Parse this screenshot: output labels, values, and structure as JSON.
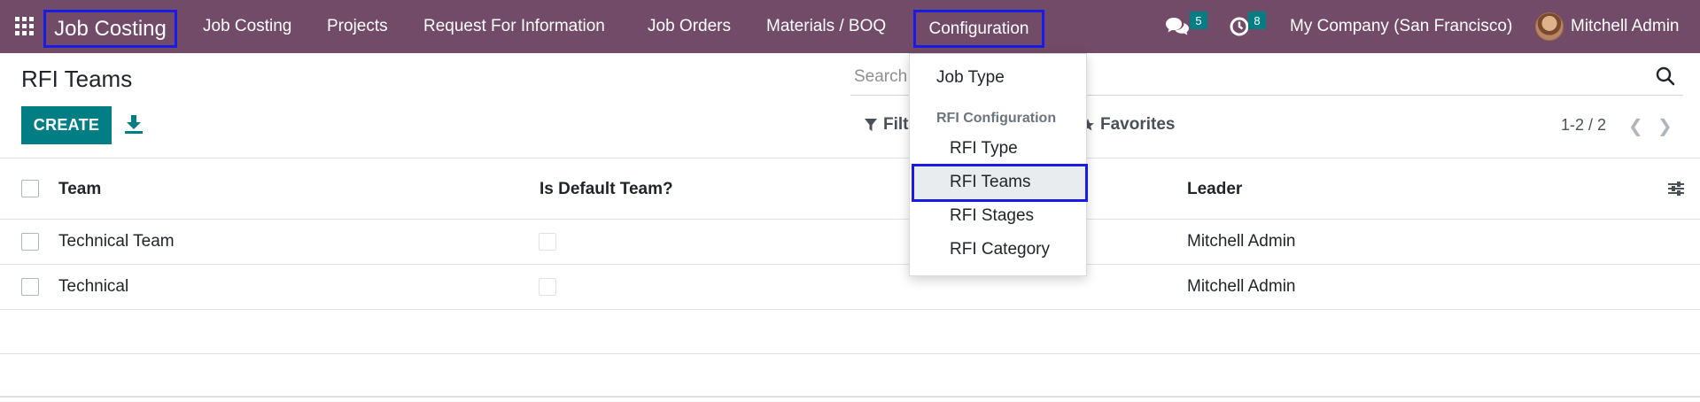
{
  "navbar": {
    "app_name": "Job Costing",
    "menus": [
      "Job Costing",
      "Projects",
      "Request For Information",
      "Job Orders",
      "Materials / BOQ",
      "Configuration"
    ],
    "messages_count": "5",
    "activities_count": "8",
    "company": "My Company (San Francisco)",
    "user": "Mitchell Admin",
    "accent_color": "#714b67",
    "highlight_color": "#1a1ae6"
  },
  "page": {
    "title": "RFI Teams",
    "create_label": "CREATE",
    "search_placeholder": "Search...",
    "filters_label": "Filters",
    "favorites_label": "Favorites",
    "pager": "1-2 / 2"
  },
  "table": {
    "columns": [
      "Team",
      "Is Default Team?",
      "Leader"
    ],
    "rows": [
      {
        "team": "Technical Team",
        "is_default": false,
        "leader": "Mitchell Admin"
      },
      {
        "team": "Technical",
        "is_default": false,
        "leader": "Mitchell Admin"
      }
    ]
  },
  "dropdown": {
    "item_job_type": "Job Type",
    "section_header": "RFI Configuration",
    "items": [
      "RFI Type",
      "RFI Teams",
      "RFI Stages",
      "RFI Category"
    ],
    "selected": "RFI Teams"
  }
}
